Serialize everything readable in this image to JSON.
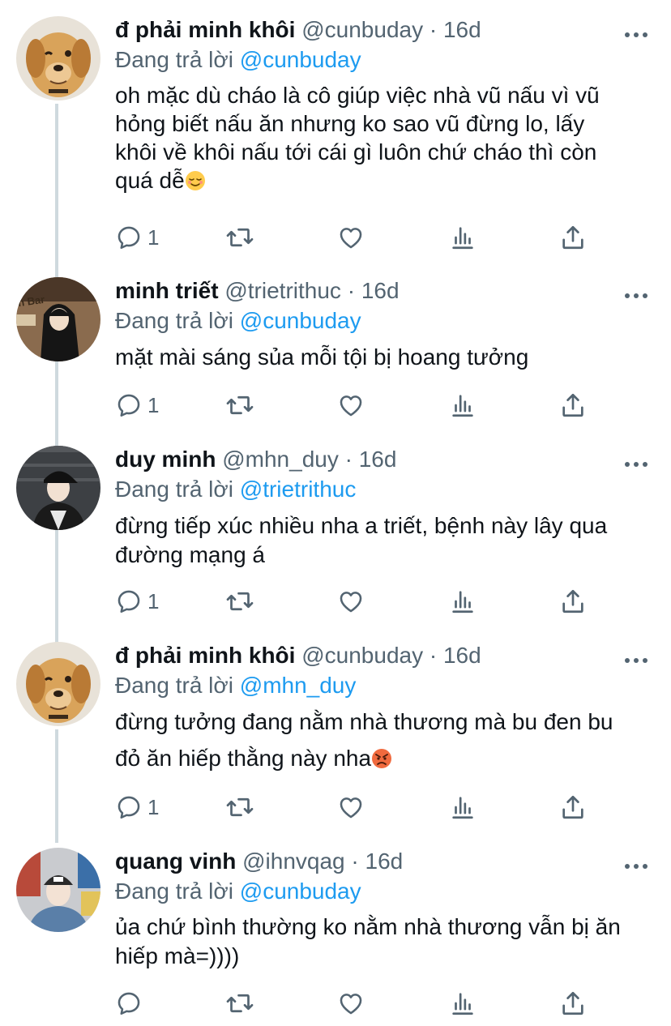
{
  "tweets": [
    {
      "name": "đ phải minh khôi",
      "handle": "@cunbuday",
      "dot": "·",
      "time": "16d",
      "replying_label": "Đang trả lời",
      "replying_to": "@cunbuday",
      "lines": [
        "oh mặc dù cháo là cô giúp việc nhà vũ nấu vì vũ",
        "hỏng biết nấu ăn nhưng ko sao vũ đừng lo, lấy",
        "khôi về khôi nấu tới cái gì luôn chứ cháo thì còn",
        "quá dễ"
      ],
      "emoji": "relieved-face",
      "reply_count": "1",
      "avatar": "golden-retriever-puppy"
    },
    {
      "name": "minh triết",
      "handle": "@trietrithuc",
      "dot": "·",
      "time": "16d",
      "replying_label": "Đang trả lời",
      "replying_to": "@cunbuday",
      "lines": [
        "mặt mài sáng sủa mỗi tội bị hoang tưởng"
      ],
      "reply_count": "1",
      "avatar": "person-in-hoodie",
      "avatar_sign_text": "n Bar"
    },
    {
      "name": "duy minh",
      "handle": "@mhn_duy",
      "dot": "·",
      "time": "16d",
      "replying_label": "Đang trả lời",
      "replying_to": "@trietrithuc",
      "lines": [
        "đừng tiếp xúc nhiều nha a triết, bệnh này lây qua",
        "đường mạng á"
      ],
      "reply_count": "1",
      "avatar": "person-in-cap"
    },
    {
      "name": "đ phải minh khôi",
      "handle": "@cunbuday",
      "dot": "·",
      "time": "16d",
      "replying_label": "Đang trả lời",
      "replying_to": "@mhn_duy",
      "lines": [
        "đừng tưởng đang nằm nhà thương mà bu đen bu",
        "đỏ ăn hiếp thằng này nha"
      ],
      "emoji": "angry-face",
      "reply_count": "1",
      "avatar": "golden-retriever-puppy"
    },
    {
      "name": "quang vinh",
      "handle": "@ihnvqag",
      "dot": "·",
      "time": "16d",
      "replying_label": "Đang trả lời",
      "replying_to": "@cunbuday",
      "lines": [
        "ủa chứ bình thường ko nằm nhà thương vẫn bị ăn",
        "hiếp mà=))))"
      ],
      "reply_count": "",
      "avatar": "person-in-beanie"
    }
  ],
  "icons": {
    "reply": "reply-icon",
    "retweet": "retweet-icon",
    "like": "like-icon",
    "views": "views-icon",
    "share": "share-icon",
    "more": "more-icon"
  },
  "colors": {
    "mention": "#1d9bf0",
    "secondary_text": "#536471",
    "thread_line": "#cfd9de"
  }
}
